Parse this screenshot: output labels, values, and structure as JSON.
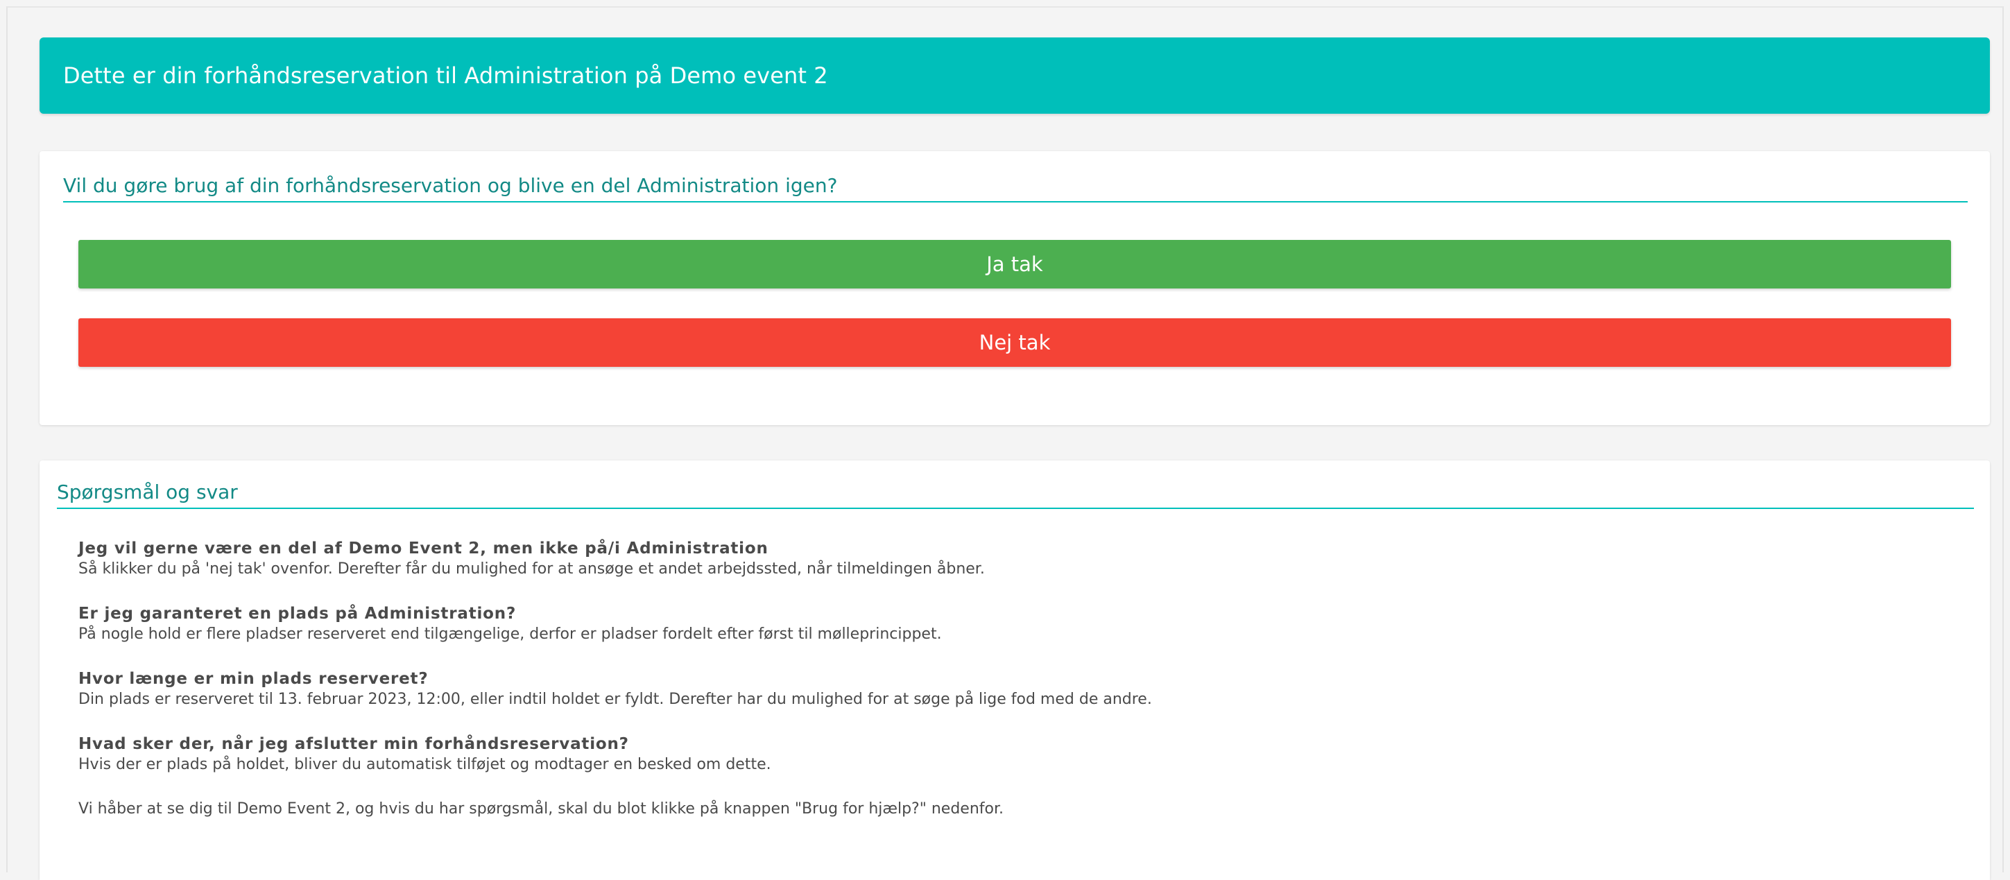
{
  "header": {
    "title": "Dette er din forhåndsreservation til Administration på Demo event 2"
  },
  "reservation": {
    "question": "Vil du gøre brug af din forhåndsreservation og blive en del Administration igen?",
    "yes_label": "Ja tak",
    "no_label": "Nej tak"
  },
  "faq": {
    "title": "Spørgsmål og svar",
    "items": [
      {
        "q": "Jeg vil gerne være en del af Demo Event 2, men ikke på/i Administration",
        "a": "Så klikker du på 'nej tak' ovenfor. Derefter får du mulighed for at ansøge et andet arbejdssted, når tilmeldingen åbner."
      },
      {
        "q": "Er jeg garanteret en plads på Administration?",
        "a": "På nogle hold er flere pladser reserveret end tilgængelige, derfor er pladser fordelt efter først til mølleprincippet."
      },
      {
        "q": "Hvor længe er min plads reserveret?",
        "a": "Din plads er reserveret til 13. februar 2023, 12:00, eller indtil holdet er fyldt. Derefter har du mulighed for at søge på lige fod med de andre."
      },
      {
        "q": "Hvad sker der, når jeg afslutter min forhåndsreservation?",
        "a": "Hvis der er plads på holdet, bliver du automatisk tilføjet og modtager en besked om dette."
      }
    ],
    "closing": "Vi håber at se dig til Demo Event 2, og hvis du har spørgsmål, skal du blot klikke på knappen \"Brug for hjælp?\" nedenfor."
  },
  "colors": {
    "accent": "#00bfba",
    "section_title": "#138a86",
    "yes_button": "#4caf50",
    "no_button": "#f44336",
    "background": "#f4f4f4"
  }
}
